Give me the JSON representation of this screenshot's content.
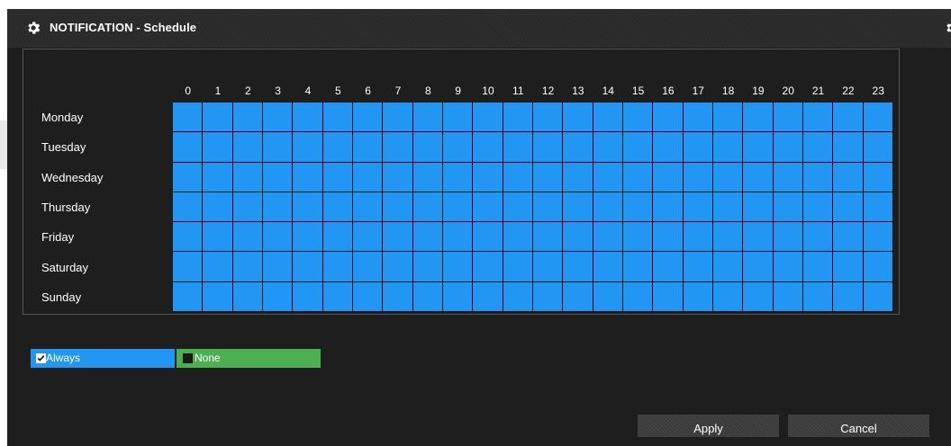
{
  "dialog": {
    "title": "NOTIFICATION - Schedule",
    "icon": "gear-icon"
  },
  "schedule": {
    "hours": [
      "0",
      "1",
      "2",
      "3",
      "4",
      "5",
      "6",
      "7",
      "8",
      "9",
      "10",
      "11",
      "12",
      "13",
      "14",
      "15",
      "16",
      "17",
      "18",
      "19",
      "20",
      "21",
      "22",
      "23"
    ],
    "days": [
      "Monday",
      "Tuesday",
      "Wednesday",
      "Thursday",
      "Friday",
      "Saturday",
      "Sunday"
    ],
    "all_selected": true,
    "cell_color": "#2196f3"
  },
  "options": {
    "always": {
      "label": "Always",
      "checked": true,
      "color": "#2196f3"
    },
    "none": {
      "label": "None",
      "checked": false,
      "color": "#4caf50"
    }
  },
  "buttons": {
    "apply": "Apply",
    "cancel": "Cancel"
  }
}
